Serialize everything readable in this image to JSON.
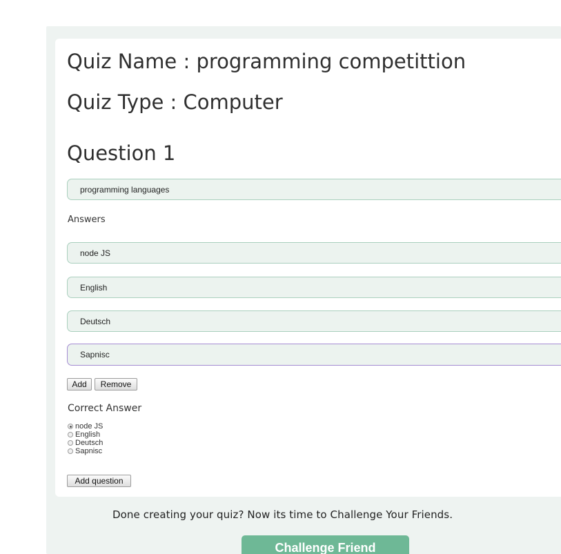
{
  "quiz": {
    "name_heading": "Quiz Name : programming competittion",
    "type_heading": "Quiz Type : Computer"
  },
  "question": {
    "heading": "Question 1",
    "text_value": "programming languages",
    "answers_label": "Answers",
    "answers": [
      {
        "value": "node JS"
      },
      {
        "value": "English"
      },
      {
        "value": "Deutsch"
      },
      {
        "value": "Sapnisc"
      }
    ],
    "add_label": "Add",
    "remove_label": "Remove",
    "correct_answer_label": "Correct Answer",
    "correct_options": [
      {
        "label": "node JS",
        "checked": true
      },
      {
        "label": "English",
        "checked": false
      },
      {
        "label": "Deutsch",
        "checked": false
      },
      {
        "label": "Sapnisc",
        "checked": false
      }
    ],
    "add_question_label": "Add question"
  },
  "footer": {
    "done_text": "Done creating your quiz? Now its time to Challenge Your Friends.",
    "challenge_label": "Challenge Friend"
  },
  "colors": {
    "field_bg": "#ecf3ef",
    "field_border": "#a9cfbd",
    "focused_border": "#a38bd2",
    "challenge_button": "#6eb896",
    "page_band": "#eef3f1"
  }
}
